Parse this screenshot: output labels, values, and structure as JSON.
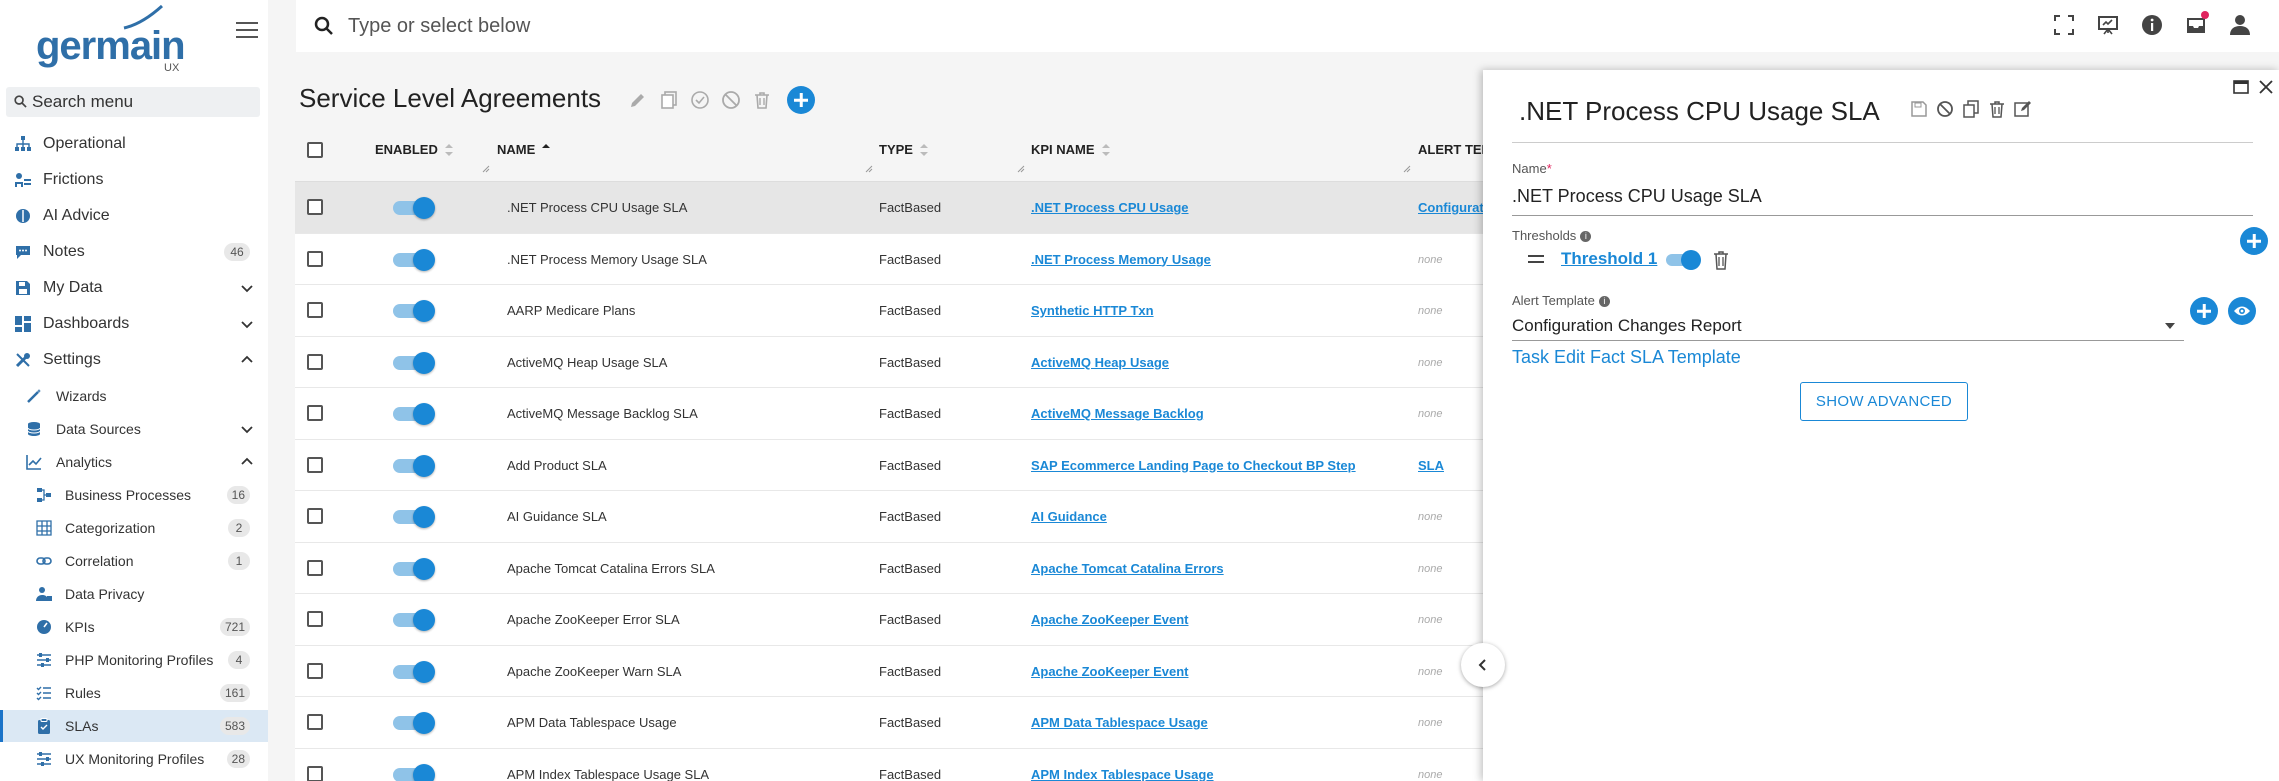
{
  "app": {
    "logo_text": "germain",
    "logo_sub": "UX"
  },
  "sidebar": {
    "search_placeholder": "Search menu",
    "items": [
      {
        "label": "Operational",
        "icon": "sitemap-icon"
      },
      {
        "label": "Frictions",
        "icon": "frictions-icon"
      },
      {
        "label": "AI Advice",
        "icon": "brain-icon"
      },
      {
        "label": "Notes",
        "icon": "comment-icon",
        "badge": "46"
      },
      {
        "label": "My Data",
        "icon": "save-icon"
      },
      {
        "label": "Dashboards",
        "icon": "dashboard-icon"
      },
      {
        "label": "Settings",
        "icon": "tools-icon"
      }
    ],
    "settings_children": [
      {
        "label": "Wizards",
        "icon": "wand-icon"
      },
      {
        "label": "Data Sources",
        "icon": "database-icon"
      },
      {
        "label": "Analytics",
        "icon": "chart-line-icon"
      }
    ],
    "analytics_children": [
      {
        "label": "Business Processes",
        "icon": "process-icon",
        "badge": "16"
      },
      {
        "label": "Categorization",
        "icon": "grid-icon",
        "badge": "2"
      },
      {
        "label": "Correlation",
        "icon": "link-icon",
        "badge": "1"
      },
      {
        "label": "Data Privacy",
        "icon": "user-lock-icon"
      },
      {
        "label": "KPIs",
        "icon": "gauge-icon",
        "badge": "721"
      },
      {
        "label": "PHP Monitoring Profiles",
        "icon": "sliders-icon",
        "badge": "4"
      },
      {
        "label": "Rules",
        "icon": "list-check-icon",
        "badge": "161"
      },
      {
        "label": "SLAs",
        "icon": "clipboard-icon",
        "badge": "583"
      },
      {
        "label": "UX Monitoring Profiles",
        "icon": "sliders-icon",
        "badge": "28"
      }
    ]
  },
  "topbar": {
    "search_placeholder": "Type or select below"
  },
  "page": {
    "title": "Service Level Agreements"
  },
  "table": {
    "headers": {
      "enabled": "ENABLED",
      "name": "NAME",
      "type": "TYPE",
      "kpi": "KPI NAME",
      "alert": "ALERT TEM"
    },
    "rows": [
      {
        "name": ".NET Process CPU Usage SLA",
        "type": "FactBased",
        "kpi": ".NET Process CPU Usage",
        "alert": "Configurati",
        "alert_is_link": true
      },
      {
        "name": ".NET Process Memory Usage SLA",
        "type": "FactBased",
        "kpi": ".NET Process Memory Usage",
        "alert": "none"
      },
      {
        "name": "AARP Medicare Plans",
        "type": "FactBased",
        "kpi": "Synthetic HTTP Txn",
        "alert": "none"
      },
      {
        "name": "ActiveMQ Heap Usage SLA",
        "type": "FactBased",
        "kpi": "ActiveMQ Heap Usage",
        "alert": "none"
      },
      {
        "name": "ActiveMQ Message Backlog SLA",
        "type": "FactBased",
        "kpi": "ActiveMQ Message Backlog",
        "alert": "none"
      },
      {
        "name": "Add Product SLA",
        "type": "FactBased",
        "kpi": "SAP Ecommerce Landing Page to Checkout BP Step",
        "alert": "SLA",
        "alert_is_link": true
      },
      {
        "name": "AI Guidance SLA",
        "type": "FactBased",
        "kpi": "AI Guidance",
        "alert": "none"
      },
      {
        "name": "Apache Tomcat Catalina Errors SLA",
        "type": "FactBased",
        "kpi": "Apache Tomcat Catalina Errors",
        "alert": "none"
      },
      {
        "name": "Apache ZooKeeper Error SLA",
        "type": "FactBased",
        "kpi": "Apache ZooKeeper Event",
        "alert": "none"
      },
      {
        "name": "Apache ZooKeeper Warn SLA",
        "type": "FactBased",
        "kpi": "Apache ZooKeeper Event",
        "alert": "none"
      },
      {
        "name": "APM Data Tablespace Usage",
        "type": "FactBased",
        "kpi": "APM Data Tablespace Usage",
        "alert": "none"
      },
      {
        "name": "APM Index Tablespace Usage SLA",
        "type": "FactBased",
        "kpi": "APM Index Tablespace Usage",
        "alert": "none"
      }
    ]
  },
  "panel": {
    "title": ".NET Process CPU Usage SLA",
    "name_label": "Name",
    "name_value": ".NET Process CPU Usage SLA",
    "thresholds_label": "Thresholds",
    "threshold_link": "Threshold 1",
    "alert_template_label": "Alert Template",
    "alert_template_value": "Configuration Changes Report",
    "task_link": "Task Edit Fact SLA Template",
    "show_advanced": "SHOW ADVANCED"
  },
  "colors": {
    "accent": "#1a88d6",
    "toggle_track": "#8fc3e8",
    "logo": "#2f6fa8",
    "active_bg": "#dbe8f4"
  }
}
